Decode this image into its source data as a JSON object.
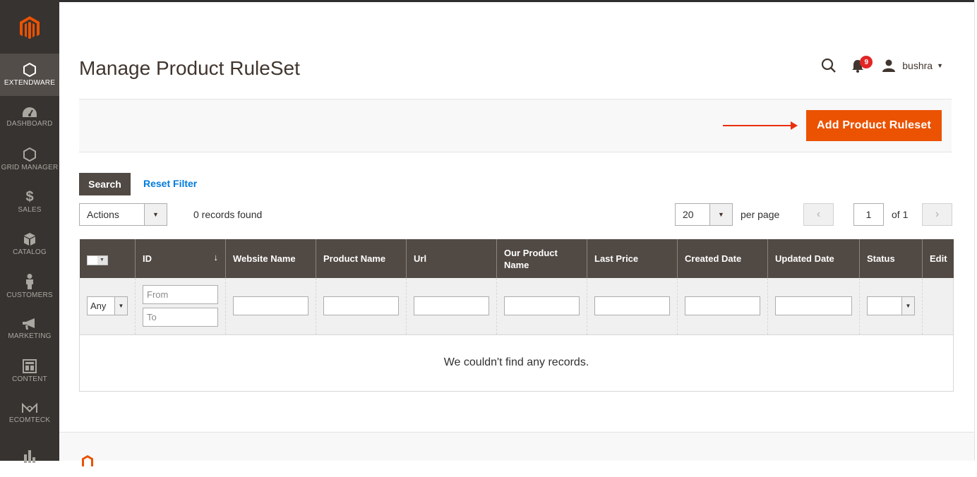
{
  "app": {
    "brand": "Magento",
    "accent": "#eb5202",
    "sidebar_bg": "#373330"
  },
  "sidebar": {
    "items": [
      {
        "label": "EXTENDWARE",
        "icon": "hexagon-icon",
        "active": true
      },
      {
        "label": "DASHBOARD",
        "icon": "speedometer-icon"
      },
      {
        "label": "GRID MANAGER",
        "icon": "hexagon-icon"
      },
      {
        "label": "SALES",
        "icon": "dollar-icon"
      },
      {
        "label": "CATALOG",
        "icon": "cube-icon"
      },
      {
        "label": "CUSTOMERS",
        "icon": "person-icon"
      },
      {
        "label": "MARKETING",
        "icon": "megaphone-icon"
      },
      {
        "label": "CONTENT",
        "icon": "layout-icon"
      },
      {
        "label": "ECOMTECK",
        "icon": "ecomteck-icon"
      },
      {
        "label": "",
        "icon": "bar-chart-icon"
      }
    ]
  },
  "header": {
    "title": "Manage Product RuleSet",
    "notifications_count": "9",
    "username": "bushra"
  },
  "toolbar": {
    "add_label": "Add Product Ruleset"
  },
  "filters": {
    "search_label": "Search",
    "reset_label": "Reset Filter",
    "actions_label": "Actions",
    "records_found": "0 records found",
    "per_page_value": "20",
    "per_page_label": "per page",
    "page_value": "1",
    "page_total": "of 1"
  },
  "grid": {
    "columns": [
      "ID",
      "Website Name",
      "Product Name",
      "Url",
      "Our Product Name",
      "Last Price",
      "Created Date",
      "Updated Date",
      "Status",
      "Edit"
    ],
    "any_label": "Any",
    "from_placeholder": "From",
    "to_placeholder": "To",
    "empty_message": "We couldn't find any records."
  }
}
